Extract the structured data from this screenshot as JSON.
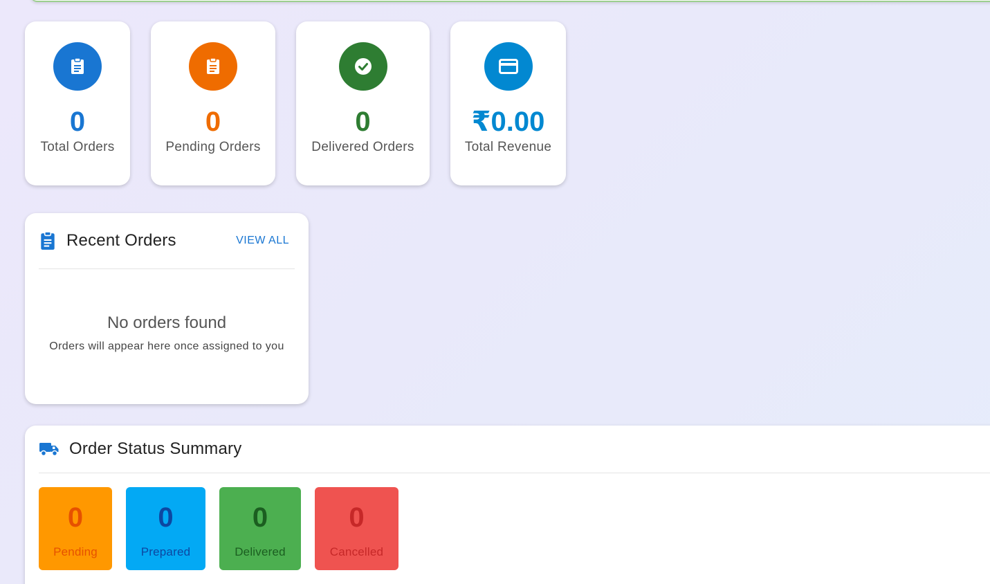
{
  "stats": [
    {
      "value": "0",
      "label": "Total Orders",
      "icon": "clipboard-icon",
      "icon_bg": "#1976d2",
      "value_color": "#1976d2"
    },
    {
      "value": "0",
      "label": "Pending Orders",
      "icon": "clipboard-icon",
      "icon_bg": "#ef6c00",
      "value_color": "#ef6c00"
    },
    {
      "value": "0",
      "label": "Delivered Orders",
      "icon": "check-circle-icon",
      "icon_bg": "#2e7d32",
      "value_color": "#2e7d32"
    },
    {
      "value": "₹0.00",
      "label": "Total Revenue",
      "icon": "credit-card-icon",
      "icon_bg": "#0288d1",
      "value_color": "#0288d1"
    }
  ],
  "recent_orders": {
    "title": "Recent Orders",
    "view_all": "VIEW ALL",
    "empty_title": "No orders found",
    "empty_subtitle": "Orders will appear here once assigned to you",
    "icon": "clipboard-icon"
  },
  "status_summary": {
    "title": "Order Status Summary",
    "icon": "truck-icon",
    "tiles": [
      {
        "count": "0",
        "label": "Pending",
        "bg": "#ff9800",
        "fg": "#e65100"
      },
      {
        "count": "0",
        "label": "Prepared",
        "bg": "#03a9f4",
        "fg": "#0d47a1"
      },
      {
        "count": "0",
        "label": "Delivered",
        "bg": "#4caf50",
        "fg": "#1b5e20"
      },
      {
        "count": "0",
        "label": "Cancelled",
        "bg": "#ef5350",
        "fg": "#c62828"
      }
    ]
  }
}
